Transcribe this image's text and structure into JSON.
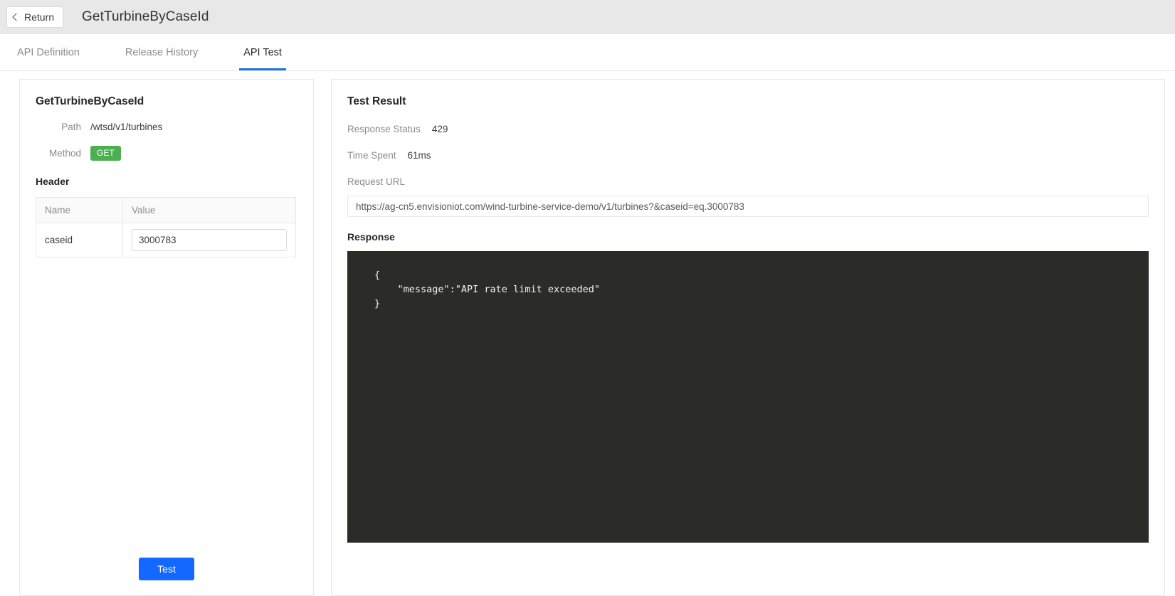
{
  "topbar": {
    "return_label": "Return",
    "title": "GetTurbineByCaseId"
  },
  "tabs": [
    {
      "label": "API Definition",
      "active": false
    },
    {
      "label": "Release History",
      "active": false
    },
    {
      "label": "API Test",
      "active": true
    }
  ],
  "left": {
    "title": "GetTurbineByCaseId",
    "path_label": "Path",
    "path_value": "/wtsd/v1/turbines",
    "method_label": "Method",
    "method_value": "GET",
    "method_color": "#4caf50",
    "header_section_label": "Header",
    "table": {
      "columns": [
        "Name",
        "Value"
      ],
      "rows": [
        {
          "name": "caseid",
          "value": "3000783"
        }
      ]
    },
    "test_button_label": "Test",
    "test_button_color": "#1467ff"
  },
  "right": {
    "title": "Test Result",
    "response_status_label": "Response Status",
    "response_status_value": "429",
    "time_spent_label": "Time Spent",
    "time_spent_value": "61ms",
    "request_url_label": "Request URL",
    "request_url_value": "https://ag-cn5.envisioniot.com/wind-turbine-service-demo/v1/turbines?&caseid=eq.3000783",
    "response_label": "Response",
    "response_body": "{\n    \"message\":\"API rate limit exceeded\"\n}"
  }
}
